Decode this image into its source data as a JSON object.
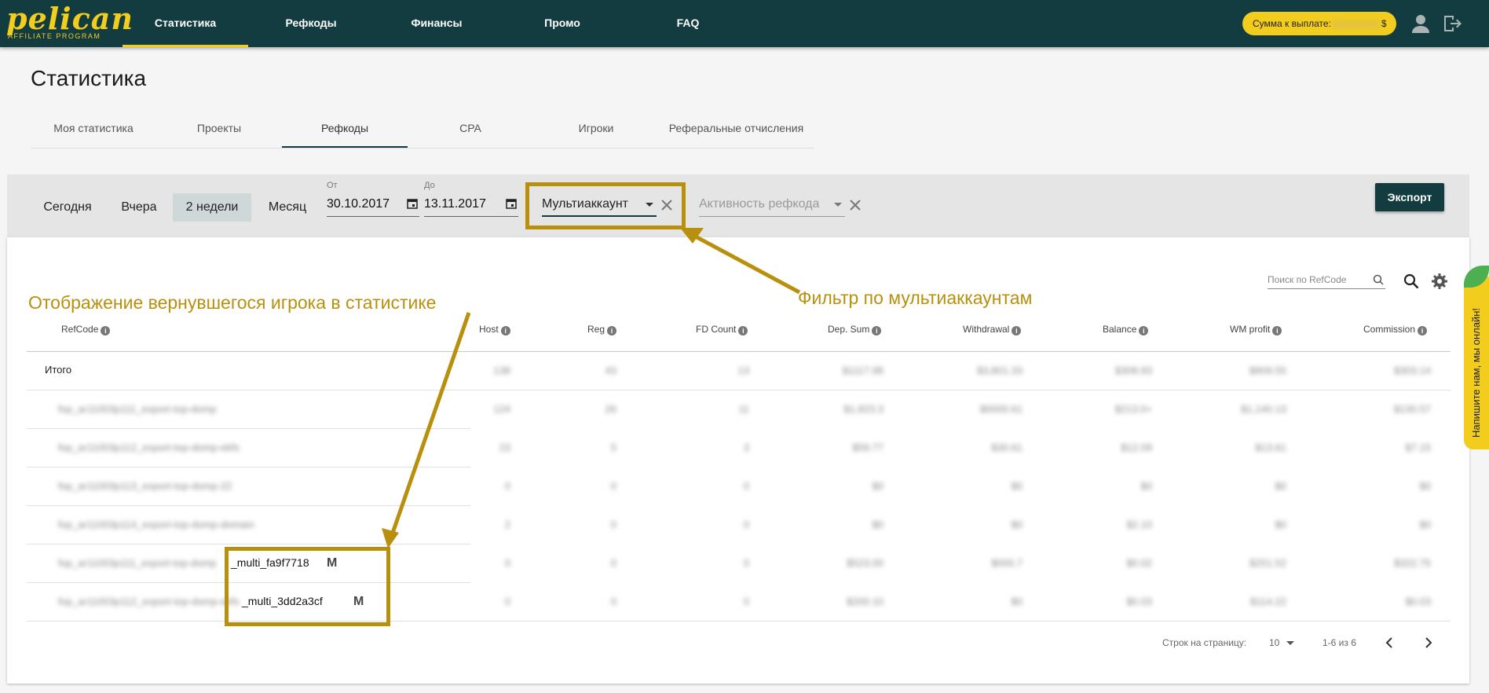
{
  "brand": {
    "logo": "pelican",
    "tagline": "AFFILIATE PROGRAM"
  },
  "nav": [
    {
      "label": "Статистика",
      "active": true
    },
    {
      "label": "Рефкоды"
    },
    {
      "label": "Финансы"
    },
    {
      "label": "Промо"
    },
    {
      "label": "FAQ"
    }
  ],
  "payout": {
    "label": "Сумма к выплате:",
    "currency": "$"
  },
  "page": {
    "title": "Статистика"
  },
  "tabs": [
    {
      "label": "Моя статистика"
    },
    {
      "label": "Проекты"
    },
    {
      "label": "Рефкоды",
      "active": true
    },
    {
      "label": "CPA"
    },
    {
      "label": "Игроки"
    },
    {
      "label": "Реферальные отчисления"
    }
  ],
  "periods": [
    {
      "label": "Сегодня"
    },
    {
      "label": "Вчера"
    },
    {
      "label": "2 недели",
      "active": true
    },
    {
      "label": "Месяц"
    }
  ],
  "date_from": {
    "label": "От",
    "value": "30.10.2017"
  },
  "date_to": {
    "label": "До",
    "value": "13.11.2017"
  },
  "filter_multi": {
    "value": "Мультиаккаунт"
  },
  "filter_activity": {
    "placeholder": "Активность рефкода"
  },
  "export_label": "Экспорт",
  "search": {
    "placeholder": "Поиск по RefCode"
  },
  "table": {
    "columns": [
      "RefCode",
      "Host",
      "Reg",
      "FD Count",
      "Dep. Sum",
      "Withdrawal",
      "Balance",
      "WM profit",
      "Commission"
    ],
    "total_label": "Итого",
    "blurred_total": [
      "138",
      "43",
      "13",
      "$1117.98",
      "$3,801.33",
      "$308.93",
      "$909.55",
      "$303.14"
    ],
    "rows": [
      {
        "refcode_blur": "fop_ar11003p111_export-top-domp",
        "values": [
          "124",
          "26",
          "11",
          "$1,823.3",
          "$0000.61",
          "$213.0+",
          "$1,140.13",
          "$130.57"
        ]
      },
      {
        "refcode_blur": "fop_ar11003p112_export-top-domp-ekfs",
        "values": [
          "23",
          "5",
          "3",
          "$59.77",
          "$30.61",
          "$12.09",
          "$13.61",
          "$7.15"
        ]
      },
      {
        "refcode_blur": "fop_ar11003p113_export-top-domp-22",
        "values": [
          "0",
          "0",
          "0",
          "$0",
          "$0",
          "$0",
          "$0",
          "$0"
        ]
      },
      {
        "refcode_blur": "fop_ar11003p114_export-top-domp-domain",
        "values": [
          "2",
          "0",
          "0",
          "$0",
          "$0",
          "$2.10",
          "$0",
          "$0"
        ]
      },
      {
        "refcode_blur": "fop_ar11003p111_export-top-domp",
        "refcode_suffix": "_multi_fa9f7718",
        "badge": "M",
        "values": [
          "0",
          "0",
          "0",
          "$523.00",
          "$000.7",
          "$0.02",
          "$251.52",
          "$322.75"
        ]
      },
      {
        "refcode_blur": "fop_ar11003p112_export-top-domp-ekfs",
        "refcode_suffix": "_multi_3dd2a3cf",
        "badge": "M",
        "values": [
          "0",
          "0",
          "0",
          "$200.10",
          "$0",
          "$0.03",
          "$114.22",
          "$0.03"
        ]
      }
    ]
  },
  "pagination": {
    "rows_label": "Строк на страницу:",
    "rows_value": "10",
    "range": "1-6 из 6"
  },
  "annotations": {
    "left": "Отображение вернувшегося игрока в статистике",
    "right": "Фильтр по мультиаккаунтам"
  },
  "chat": {
    "label": "Напишите нам, мы онлайн!"
  },
  "colors": {
    "header": "#123c3f",
    "accent": "#f2cd1e",
    "annotation": "#b8900e"
  }
}
